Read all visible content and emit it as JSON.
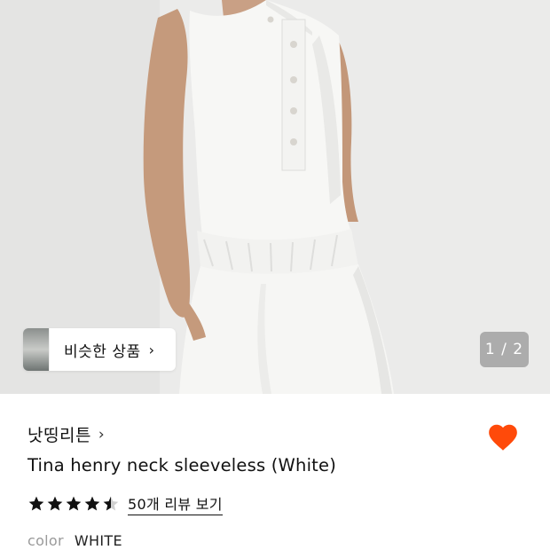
{
  "product_image": {
    "alt_subject": "model-wearing-white-sleeveless-henley-and-shorts"
  },
  "similar_products": {
    "label": "비슷한 상품",
    "chevron": "›"
  },
  "pager": {
    "text": "1 / 2"
  },
  "brand": {
    "name": "낫띵리튼",
    "chevron": "›"
  },
  "wishlist": {
    "state": "active",
    "color": "#ff4a0a"
  },
  "product": {
    "title": "Tina henry neck sleeveless (White)"
  },
  "rating": {
    "stars": 4.5,
    "review_link": "50개 리뷰 보기"
  },
  "option": {
    "label": "color",
    "value": "WHITE"
  }
}
